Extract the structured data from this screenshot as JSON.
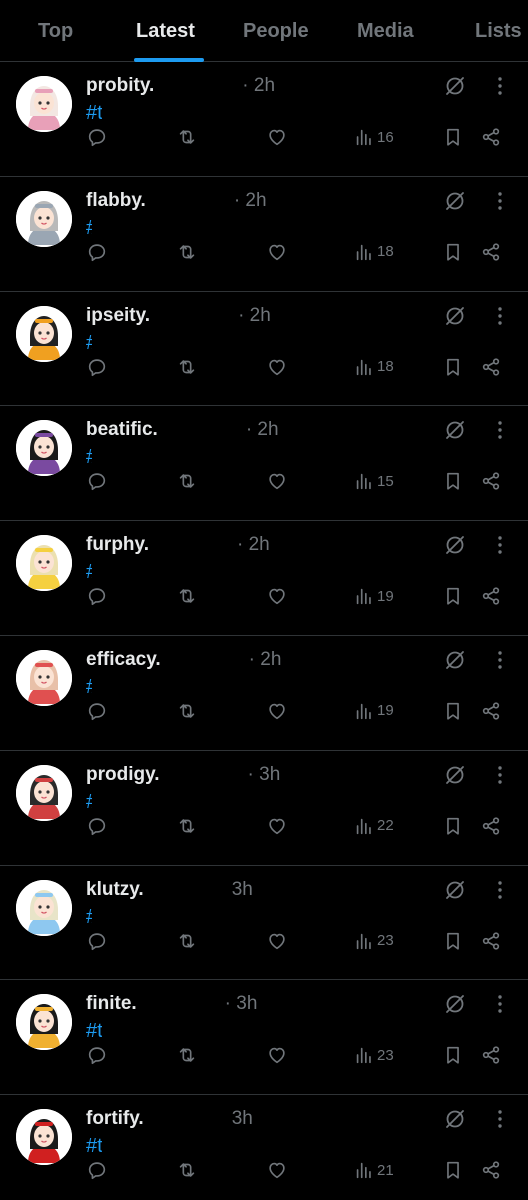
{
  "tabs": [
    {
      "label": "Top",
      "active": false
    },
    {
      "label": "Latest",
      "active": true
    },
    {
      "label": "People",
      "active": false
    },
    {
      "label": "Media",
      "active": false
    },
    {
      "label": "Lists",
      "active": false
    }
  ],
  "colors": {
    "background": "#000000",
    "accent": "#1d9bf0",
    "text_primary": "#e7e9ea",
    "text_secondary": "#71767b",
    "divider": "#2f3336"
  },
  "icons": {
    "reply": "reply-icon",
    "repost": "repost-icon",
    "like": "heart-icon",
    "views": "views-icon",
    "bookmark": "bookmark-icon",
    "share": "share-icon",
    "grok": "grok-icon",
    "more": "more-icon"
  },
  "posts": [
    {
      "name": "probity.",
      "time": "· 2h",
      "hashtag": "#tes",
      "views": "16",
      "avatar_accent": "#e8a0b8",
      "avatar_hair": "#f3e7e2"
    },
    {
      "name": "flabby.",
      "time": "· 2h",
      "hashtag": "#te",
      "views": "18",
      "avatar_accent": "#9aa6b3",
      "avatar_hair": "#b9b9b9"
    },
    {
      "name": "ipseity.",
      "time": "· 2h",
      "hashtag": "#te",
      "views": "18",
      "avatar_accent": "#f0a020",
      "avatar_hair": "#222222"
    },
    {
      "name": "beatific.",
      "time": "· 2h",
      "hashtag": "#te",
      "views": "15",
      "avatar_accent": "#7a4aa0",
      "avatar_hair": "#1a1a1a"
    },
    {
      "name": "furphy.",
      "time": "· 2h",
      "hashtag": "#te",
      "views": "19",
      "avatar_accent": "#f5d040",
      "avatar_hair": "#ece0b0"
    },
    {
      "name": "efficacy.",
      "time": "· 2h",
      "hashtag": "#te",
      "views": "19",
      "avatar_accent": "#e05050",
      "avatar_hair": "#e8c0a8"
    },
    {
      "name": "prodigy.",
      "time": "· 3h",
      "hashtag": "#te",
      "views": "22",
      "avatar_accent": "#d04040",
      "avatar_hair": "#2a2a2a"
    },
    {
      "name": "klutzy.",
      "time": "3h",
      "hashtag": "#te",
      "views": "23",
      "avatar_accent": "#8ec8f0",
      "avatar_hair": "#e8e4c8"
    },
    {
      "name": "finite.",
      "time": "· 3h",
      "hashtag": "#tes",
      "views": "23",
      "avatar_accent": "#f0b030",
      "avatar_hair": "#1a1a1a"
    },
    {
      "name": "fortify.",
      "time": "3h",
      "hashtag": "#tes",
      "views": "21",
      "avatar_accent": "#d02020",
      "avatar_hair": "#1a1a1a"
    }
  ]
}
